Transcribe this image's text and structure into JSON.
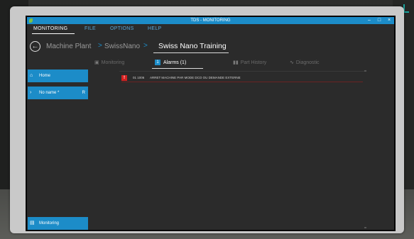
{
  "window": {
    "title": "TDS - MONITORING",
    "controls": {
      "minimize": "–",
      "maximize": "□",
      "close": "×"
    }
  },
  "menu": {
    "items": [
      {
        "label": "MONITORING",
        "active": true
      },
      {
        "label": "FILE"
      },
      {
        "label": "OPTIONS"
      },
      {
        "label": "HELP"
      }
    ]
  },
  "breadcrumb": {
    "items": [
      "Machine Plant",
      "SwissNano",
      "Swiss Nano Training"
    ],
    "separator": ">"
  },
  "tabs": [
    {
      "label": "Monitoring",
      "icon": "gauge-icon"
    },
    {
      "label": "Alarms (1)",
      "badge": "1",
      "active": true
    },
    {
      "label": "Part History",
      "icon": "bars-icon"
    },
    {
      "label": "Diagnostic",
      "icon": "pulse-icon"
    }
  ],
  "sidebar": {
    "items": [
      {
        "label": "Home",
        "icon": "home-icon"
      },
      {
        "label": "No name *",
        "icon": "chevron-right-icon",
        "mark": "R"
      },
      {
        "label": "Monitoring",
        "icon": "monitor-icon"
      }
    ]
  },
  "alarms": [
    {
      "badge": "!",
      "code": "01 1006",
      "message": "ARRET MACHINE PAR MODE DCO OU DEMANDE EXTERNE"
    }
  ],
  "colors": {
    "accent": "#1c8cc8",
    "alarm": "#d42020",
    "background": "#2b2b2b"
  }
}
